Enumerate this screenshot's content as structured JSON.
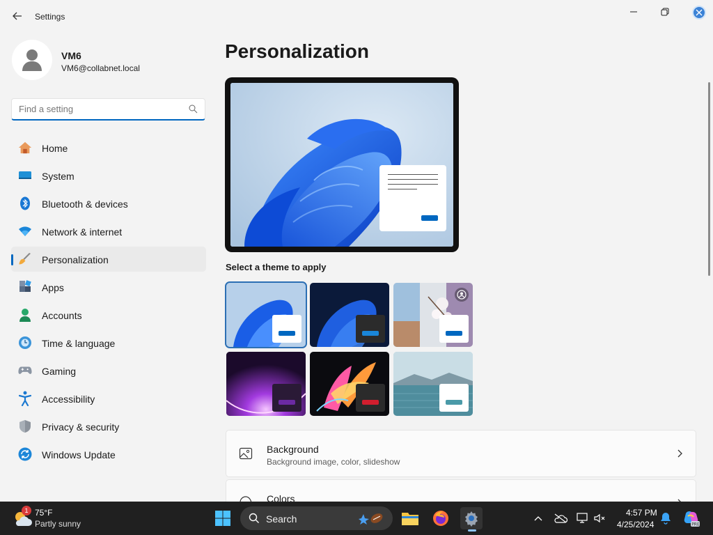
{
  "app": {
    "title": "Settings"
  },
  "user": {
    "name": "VM6",
    "email": "VM6@collabnet.local"
  },
  "search": {
    "placeholder": "Find a setting"
  },
  "sidebar": {
    "items": [
      {
        "label": "Home",
        "icon": "home-icon"
      },
      {
        "label": "System",
        "icon": "system-icon"
      },
      {
        "label": "Bluetooth & devices",
        "icon": "bluetooth-icon"
      },
      {
        "label": "Network & internet",
        "icon": "wifi-icon"
      },
      {
        "label": "Personalization",
        "icon": "brush-icon",
        "active": true
      },
      {
        "label": "Apps",
        "icon": "apps-icon"
      },
      {
        "label": "Accounts",
        "icon": "accounts-icon"
      },
      {
        "label": "Time & language",
        "icon": "clock-globe-icon"
      },
      {
        "label": "Gaming",
        "icon": "gamepad-icon"
      },
      {
        "label": "Accessibility",
        "icon": "accessibility-icon"
      },
      {
        "label": "Privacy & security",
        "icon": "shield-icon"
      },
      {
        "label": "Windows Update",
        "icon": "update-icon"
      }
    ]
  },
  "main": {
    "title": "Personalization",
    "themes_heading": "Select a theme to apply",
    "themes": [
      {
        "name": "windows-light",
        "selected": true
      },
      {
        "name": "windows-dark"
      },
      {
        "name": "spotlight"
      },
      {
        "name": "glow"
      },
      {
        "name": "captured-motion"
      },
      {
        "name": "flow"
      }
    ],
    "cards": [
      {
        "title": "Background",
        "subtitle": "Background image, color, slideshow",
        "icon": "picture-icon"
      },
      {
        "title": "Colors",
        "subtitle": "",
        "icon": "palette-icon"
      }
    ]
  },
  "taskbar": {
    "weather": {
      "temp": "75°F",
      "desc": "Partly sunny",
      "badge": "1"
    },
    "search_label": "Search",
    "time": "4:57 PM",
    "date": "4/25/2024"
  },
  "colors": {
    "accent": "#0067c0",
    "taskbar": "#202020"
  }
}
